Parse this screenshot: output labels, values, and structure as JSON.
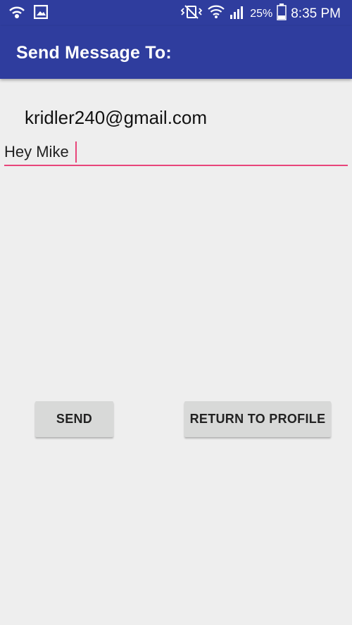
{
  "status_bar": {
    "battery_percent": "25%",
    "time": "8:35 PM",
    "icons": [
      "wifi-call-icon",
      "image-icon",
      "vibrate-icon",
      "wifi-icon",
      "signal-icon",
      "battery-icon"
    ]
  },
  "app_bar": {
    "title": "Send Message To:",
    "color": "#2f3d9e"
  },
  "recipient": {
    "email": "kridler240@gmail.com"
  },
  "message": {
    "value": "Hey Mike",
    "accent_color": "#e8457a"
  },
  "buttons": {
    "send_label": "SEND",
    "return_label": "RETURN TO PROFILE"
  }
}
